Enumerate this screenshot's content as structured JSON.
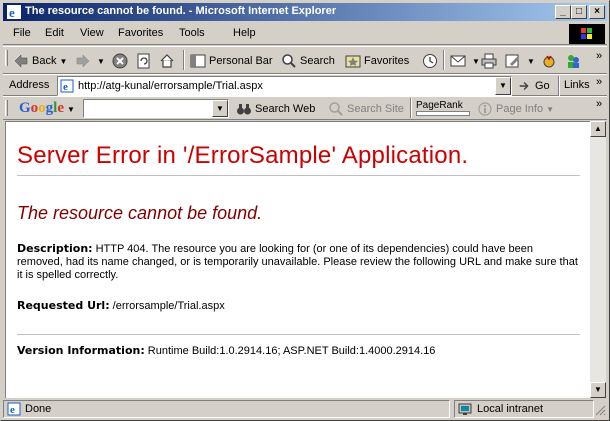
{
  "window": {
    "title": "The resource cannot be found. - Microsoft Internet Explorer"
  },
  "menu": [
    "File",
    "Edit",
    "View",
    "Favorites",
    "Tools",
    "Help"
  ],
  "toolbar": {
    "back": "Back",
    "personal_bar": "Personal Bar",
    "search": "Search",
    "favorites": "Favorites"
  },
  "address": {
    "label": "Address",
    "url": "http://atg-kunal/errorsample/Trial.aspx",
    "go": "Go",
    "links": "Links"
  },
  "google_bar": {
    "logo": "Google",
    "search_web": "Search Web",
    "search_site": "Search Site",
    "pagerank": "PageRank",
    "page_info": "Page Info"
  },
  "page": {
    "heading": "Server Error in '/ErrorSample' Application.",
    "subheading": "The resource cannot be found.",
    "description_label": "Description:",
    "description_text": "HTTP 404. The resource you are looking for (or one of its dependencies) could have been removed, had its name changed, or is temporarily unavailable. Please review the following URL and make sure that it is spelled correctly.",
    "requested_url_label": "Requested Url:",
    "requested_url": "/errorsample/Trial.aspx",
    "version_label": "Version Information:",
    "version_text": "Runtime Build:1.0.2914.16; ASP.NET Build:1.4000.2914.16"
  },
  "status": {
    "text": "Done",
    "zone": "Local intranet"
  },
  "colors": {
    "title_start": "#0a246a",
    "title_end": "#a6caf0",
    "error_red": "#cc0000",
    "subheading": "#800000"
  }
}
